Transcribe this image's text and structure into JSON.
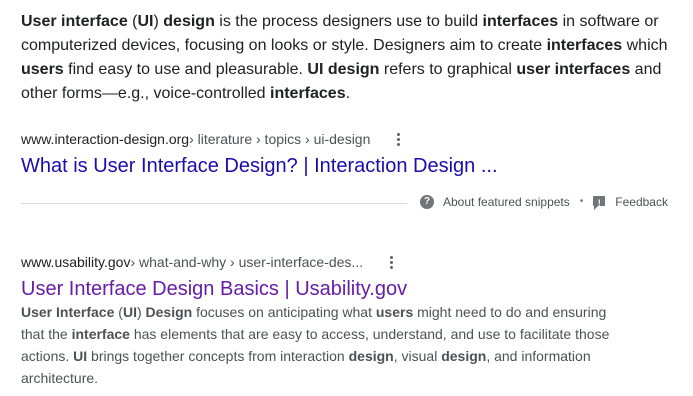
{
  "featured_snippet": {
    "text": [
      {
        "t": "User interface",
        "b": true
      },
      {
        "t": " (",
        "b": false
      },
      {
        "t": "UI",
        "b": true
      },
      {
        "t": ") ",
        "b": false
      },
      {
        "t": "design",
        "b": true
      },
      {
        "t": " is the process designers use to build ",
        "b": false
      },
      {
        "t": "interfaces",
        "b": true
      },
      {
        "t": " in software or computerized devices, focusing on looks or style. Designers aim to create ",
        "b": false
      },
      {
        "t": "interfaces",
        "b": true
      },
      {
        "t": " which ",
        "b": false
      },
      {
        "t": "users",
        "b": true
      },
      {
        "t": " find easy to use and pleasurable. ",
        "b": false
      },
      {
        "t": "UI design",
        "b": true
      },
      {
        "t": " refers to graphical ",
        "b": false
      },
      {
        "t": "user interfaces",
        "b": true
      },
      {
        "t": " and other forms—e.g., voice-controlled ",
        "b": false
      },
      {
        "t": "interfaces",
        "b": true
      },
      {
        "t": ".",
        "b": false
      }
    ],
    "cite_domain": "www.interaction-design.org",
    "cite_path": " › literature › topics › ui-design",
    "title": "What is User Interface Design? | Interaction Design ...",
    "about_label": "About featured snippets",
    "separator": "•",
    "feedback_label": "Feedback"
  },
  "result": {
    "cite_domain": "www.usability.gov",
    "cite_path": " › what-and-why › user-interface-des...",
    "title": "User Interface Design Basics | Usability.gov",
    "description": [
      {
        "t": "User Interface",
        "b": true
      },
      {
        "t": " (",
        "b": false
      },
      {
        "t": "UI",
        "b": true
      },
      {
        "t": ") ",
        "b": false
      },
      {
        "t": "Design",
        "b": true
      },
      {
        "t": " focuses on anticipating what ",
        "b": false
      },
      {
        "t": "users",
        "b": true
      },
      {
        "t": " might need to do and ensuring that the ",
        "b": false
      },
      {
        "t": "interface",
        "b": true
      },
      {
        "t": " has elements that are easy to access, understand, and use to facilitate those actions. ",
        "b": false
      },
      {
        "t": "UI",
        "b": true
      },
      {
        "t": " brings together concepts from interaction ",
        "b": false
      },
      {
        "t": "design",
        "b": true
      },
      {
        "t": ", visual ",
        "b": false
      },
      {
        "t": "design",
        "b": true
      },
      {
        "t": ", and information architecture.",
        "b": false
      }
    ]
  },
  "icons": {
    "menu": "more-vert-icon",
    "help": "help-circle-icon",
    "feedback": "feedback-icon"
  },
  "colors": {
    "link_unvisited": "#1a0dab",
    "link_visited": "#681da8",
    "body_text": "#202124",
    "secondary_text": "#4d5156"
  }
}
